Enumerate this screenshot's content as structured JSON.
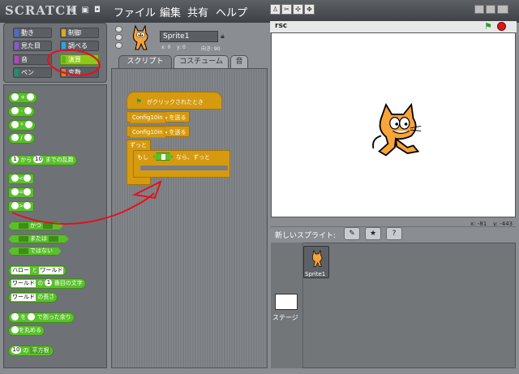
{
  "topbar": {
    "logo": "SCRATCH",
    "menus": [
      "ファイル",
      "編集",
      "共有",
      "ヘルプ"
    ]
  },
  "categories": [
    {
      "label": "動き",
      "color": "#4a6cd4"
    },
    {
      "label": "制御",
      "color": "#e1a91a"
    },
    {
      "label": "見た目",
      "color": "#8a55d7"
    },
    {
      "label": "調べる",
      "color": "#2ca5e2"
    },
    {
      "label": "音",
      "color": "#bb42c3"
    },
    {
      "label": "演算",
      "color": "#5cb712"
    },
    {
      "label": "ペン",
      "color": "#0e9a6c"
    },
    {
      "label": "変数",
      "color": "#ee7d16"
    }
  ],
  "palette": {
    "random_from": "から",
    "random_to": "までの乱数",
    "random_a": "1",
    "random_b": "10",
    "lt": "<",
    "eq": "=",
    "gt": ">",
    "and": "かつ",
    "or": "または",
    "not": "ではない",
    "join_a": "ハロー",
    "join_mid": "と",
    "join_b": "ワールド",
    "letter_a": "ワールド",
    "letter_mid": "の",
    "letter_num": "1",
    "letter_end": "番目の文字",
    "length_a": "ワールド",
    "length_end": "の長さ",
    "mod_a": "を",
    "mod_end": "で割った余り",
    "round_end": "を丸める",
    "sqrt_val": "10",
    "sqrt_mid": "の",
    "sqrt_fn": "平方根"
  },
  "sprite": {
    "name": "Sprite1",
    "x_label": "x: 0",
    "y_label": "y: 0",
    "dir_label": "向き: 90"
  },
  "tabs": [
    "スクリプト",
    "コスチューム",
    "音"
  ],
  "script": {
    "hat": "がクリックされたとき",
    "send1_msg": "Config10in",
    "send1_label": "を送る",
    "send2_msg": "Config10in",
    "send2_label": "を送る",
    "forever": "ずっと",
    "if_label": "もし",
    "if_end": "なら、ずっと"
  },
  "stage": {
    "title": "rsc",
    "mouse_x": "x: -81",
    "mouse_y": "y: -443"
  },
  "new_sprite_label": "新しいスプライト:",
  "stage_label": "ステージ",
  "sprite_thumb_label": "Sprite1"
}
